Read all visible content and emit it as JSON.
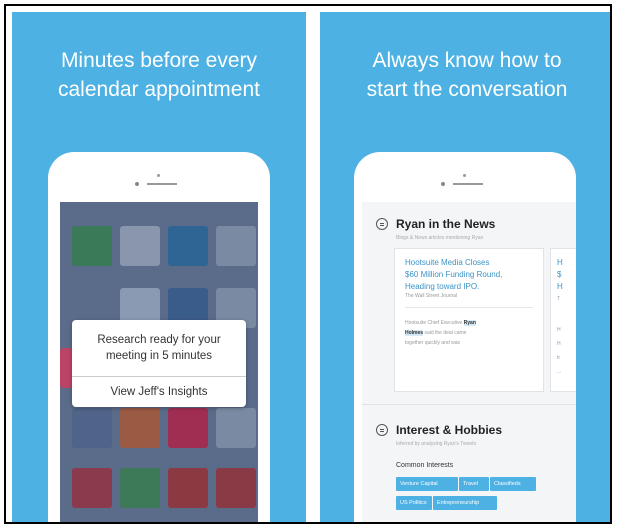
{
  "left_panel": {
    "headline": [
      "Minutes before every",
      "calendar appointment"
    ],
    "notification": {
      "message_line1": "Research ready for your",
      "message_line2": "meeting in 5 minutes",
      "action": "View Jeff's Insights"
    },
    "tile_colors": [
      "#3b7a58",
      "#8a96ad",
      "#2f6594",
      "#7a8aa3",
      "#8a9ab3",
      "#3a5c8a",
      "#bb4466",
      "#9a5a44",
      "#a02d52",
      "#7a8aa3",
      "#8a3a4a",
      "#3c7a58",
      "#8b3a42",
      "#8a3a44"
    ],
    "colors": {
      "background": "#4db1e3",
      "screen": "#5b6b8a"
    }
  },
  "right_panel": {
    "headline": [
      "Always know how to",
      "start the conversation"
    ],
    "news_section": {
      "title": "Ryan in the News",
      "subtitle": "Blogs & News articles mentioning Ryan",
      "article_title": [
        "Hootsuite Media Closes",
        "$60 Million Funding Round,",
        "Heading toward IPO."
      ],
      "article_source": "The Wall Street Journal",
      "snippet_line1_pre": "Hootsuite Chief Executive ",
      "snippet_line1_hl": "Ryan",
      "snippet_line2_hl": "Holmes",
      "snippet_line2_post": " said the deal came",
      "snippet_line3": "together quickly and was",
      "second_card_letters": [
        "H",
        "$",
        "H",
        "T"
      ],
      "second_card_snip": [
        "H",
        "H",
        "tr",
        "..."
      ]
    },
    "interests_section": {
      "title": "Interest & Hobbies",
      "subtitle": "Inferred by analyzing Ryan's Tweets",
      "common_label": "Common Interests",
      "tags": [
        "Venture Capital",
        "Travel",
        "Classifieds",
        "US Politics",
        "Entrepreneurship"
      ]
    }
  }
}
